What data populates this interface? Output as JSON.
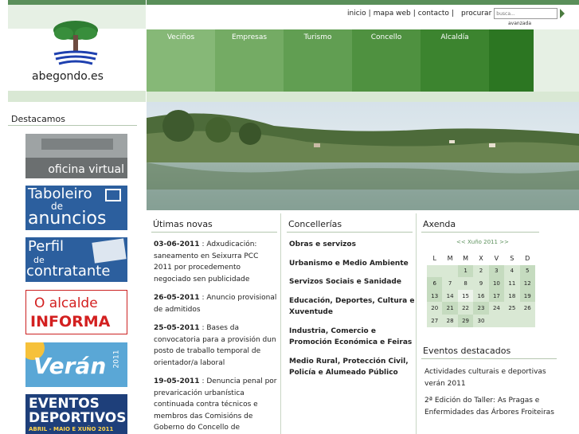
{
  "site": {
    "logo_text": "abegondo.es"
  },
  "util_nav": {
    "links": [
      "inicio",
      "mapa web",
      "contacto"
    ],
    "search_label": "procurar",
    "search_placeholder": "busca...",
    "advanced_label": "avanzada"
  },
  "main_nav": {
    "tabs": [
      "Veciños",
      "Empresas",
      "Turismo",
      "Concello",
      "Alcaldía"
    ],
    "colors": [
      "#7fb26f",
      "#6fa65f",
      "#5f9a50",
      "#4f8e42",
      "#3f8234",
      "#2f7627"
    ]
  },
  "sidebar": {
    "title": "Destacamos",
    "banners": [
      {
        "name": "oficina-virtual",
        "label": "oficina virtual"
      },
      {
        "name": "taboleiro-de-anuncios",
        "line1": "Taboleiro",
        "line2": "de",
        "line3": "anuncios"
      },
      {
        "name": "perfil-de-contratante",
        "line1": "Perfil",
        "line2": "de",
        "line3": "contratante"
      },
      {
        "name": "o-alcalde-informa",
        "line1": "O alcalde",
        "line2": "INFORMA"
      },
      {
        "name": "veran-2011",
        "line1": "Verán",
        "line2": "2011"
      },
      {
        "name": "eventos-deportivos",
        "line1": "EVENTOS",
        "line2": "DEPORTIVOS",
        "line3": "ABRIL - MAIO E XUÑO 2011"
      }
    ]
  },
  "news": {
    "title": "Útimas novas",
    "items": [
      {
        "date": "03-06-2011",
        "text": " : Adxudicación: saneamento en Seixurra PCC 2011 por procedemento negociado sen publicidade"
      },
      {
        "date": "26-05-2011",
        "text": " : Anuncio provisional de admitidos"
      },
      {
        "date": "25-05-2011",
        "text": " : Bases da convocatoria para a provisión dun posto de traballo temporal de orientador/a laboral"
      },
      {
        "date": "19-05-2011",
        "text": " : Denuncia penal por prevaricación urbanística continuada contra técnicos e membros das Comisións de Goberno do Concello de Abegondo"
      }
    ]
  },
  "concellerias": {
    "title": "Concellerías",
    "items": [
      "Obras e servizos",
      "Urbanismo e Medio Ambiente",
      "Servizos Sociais e Sanidade",
      "Educación, Deportes, Cultura e Xuventude",
      "Industria, Comercio e Promoción Económica e Feiras",
      "Medio Rural, Protección Civil, Policía e Alumeado Público"
    ]
  },
  "agenda": {
    "title": "Axenda",
    "month_nav": "<< Xuño 2011 >>",
    "weekdays": [
      "L",
      "M",
      "M",
      "X",
      "V",
      "S",
      "D"
    ],
    "weeks": [
      [
        "",
        "",
        "1",
        "2",
        "3",
        "4",
        "5"
      ],
      [
        "6",
        "7",
        "8",
        "9",
        "10",
        "11",
        "12"
      ],
      [
        "13",
        "14",
        "15",
        "16",
        "17",
        "18",
        "19"
      ],
      [
        "20",
        "21",
        "22",
        "23",
        "24",
        "25",
        "26"
      ],
      [
        "27",
        "28",
        "29",
        "30",
        "",
        "",
        ""
      ]
    ]
  },
  "events": {
    "title": "Eventos destacados",
    "items": [
      "Actividades culturais e deportivas verán 2011",
      "2ª Edición do Taller: As Pragas e Enfermidades das Árbores Froiteiras"
    ]
  }
}
